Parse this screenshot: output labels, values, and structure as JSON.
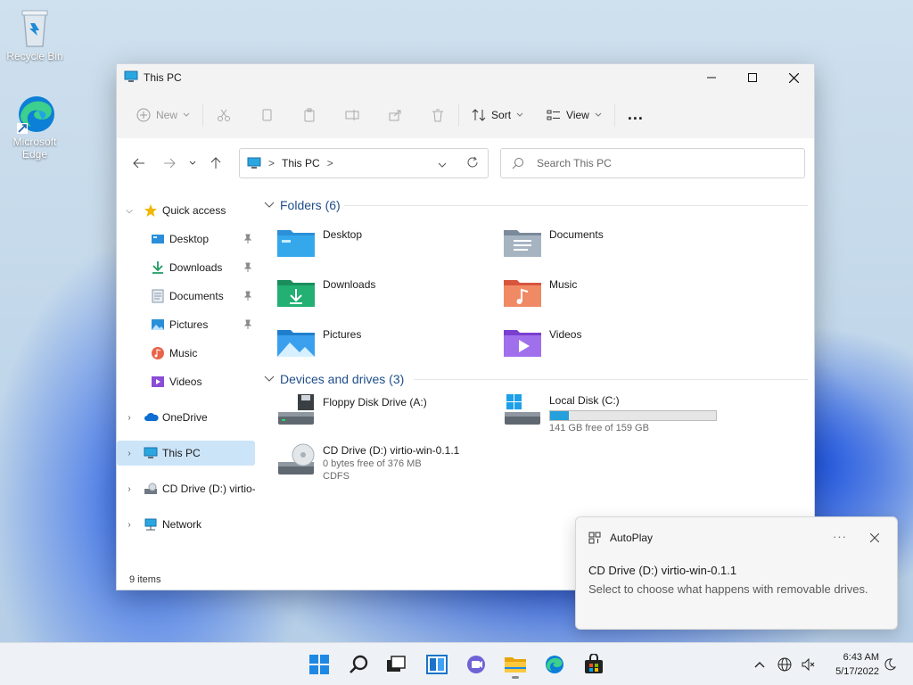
{
  "desktop": {
    "icons": [
      {
        "label": "Recycle Bin"
      },
      {
        "label": "Microsoft Edge"
      }
    ]
  },
  "window": {
    "title": "This PC",
    "commands": {
      "new": "New",
      "sort": "Sort",
      "view": "View",
      "more": "..."
    },
    "address": {
      "root_label": "This PC",
      "separator": ">"
    },
    "search": {
      "placeholder": "Search This PC"
    },
    "sidebar": {
      "quick_access": "Quick access",
      "quick_items": [
        {
          "label": "Desktop",
          "pinned": true
        },
        {
          "label": "Downloads",
          "pinned": true
        },
        {
          "label": "Documents",
          "pinned": true
        },
        {
          "label": "Pictures",
          "pinned": true
        },
        {
          "label": "Music",
          "pinned": false
        },
        {
          "label": "Videos",
          "pinned": false
        }
      ],
      "onedrive": "OneDrive",
      "this_pc": "This PC",
      "cd_drive": "CD Drive (D:) virtio-w",
      "network": "Network"
    },
    "folders": {
      "header": "Folders (6)",
      "items": [
        {
          "label": "Desktop"
        },
        {
          "label": "Documents"
        },
        {
          "label": "Downloads"
        },
        {
          "label": "Music"
        },
        {
          "label": "Pictures"
        },
        {
          "label": "Videos"
        }
      ]
    },
    "drives": {
      "header": "Devices and drives (3)",
      "items": [
        {
          "label": "Floppy Disk Drive (A:)"
        },
        {
          "label": "Local Disk (C:)",
          "free_text": "141 GB free of 159 GB",
          "used_fraction": 0.113
        },
        {
          "label": "CD Drive (D:) virtio-win-0.1.1",
          "line2": "0 bytes free of 376 MB",
          "line3": "CDFS"
        }
      ]
    },
    "status": "9 items"
  },
  "toast": {
    "app": "AutoPlay",
    "more": "···",
    "title": "CD Drive (D:) virtio-win-0.1.1",
    "body": "Select to choose what happens with removable drives."
  },
  "taskbar": {
    "time": "6:43 AM",
    "date": "5/17/2022"
  },
  "colors": {
    "accent": "#0067c0",
    "selection": "#cce4f7",
    "progress": "#26a0da"
  }
}
